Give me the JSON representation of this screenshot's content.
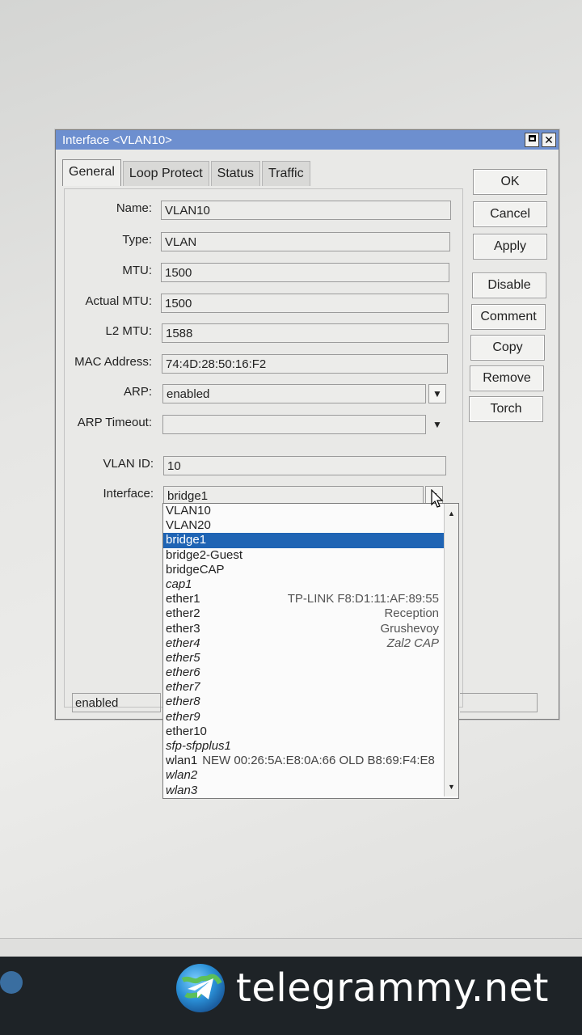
{
  "window": {
    "title": "Interface <VLAN10>"
  },
  "tabs": [
    "General",
    "Loop Protect",
    "Status",
    "Traffic"
  ],
  "fields": {
    "name": {
      "label": "Name:",
      "value": "VLAN10"
    },
    "type": {
      "label": "Type:",
      "value": "VLAN"
    },
    "mtu": {
      "label": "MTU:",
      "value": "1500"
    },
    "actual_mtu": {
      "label": "Actual MTU:",
      "value": "1500"
    },
    "l2_mtu": {
      "label": "L2 MTU:",
      "value": "1588"
    },
    "mac": {
      "label": "MAC Address:",
      "value": "74:4D:28:50:16:F2"
    },
    "arp": {
      "label": "ARP:",
      "value": "enabled"
    },
    "arp_timeout": {
      "label": "ARP Timeout:",
      "value": ""
    },
    "vlan_id": {
      "label": "VLAN ID:",
      "value": "10"
    },
    "interface": {
      "label": "Interface:",
      "value": "bridge1"
    }
  },
  "buttons": [
    "OK",
    "Cancel",
    "Apply",
    "Disable",
    "Comment",
    "Copy",
    "Remove",
    "Torch"
  ],
  "status": "enabled",
  "dropdown": {
    "items": [
      {
        "name": "VLAN10",
        "comment": ""
      },
      {
        "name": "VLAN20",
        "comment": ""
      },
      {
        "name": "bridge1",
        "comment": "",
        "selected": true
      },
      {
        "name": "bridge2-Guest",
        "comment": ""
      },
      {
        "name": "bridgeCAP",
        "comment": ""
      },
      {
        "name": "cap1",
        "comment": "",
        "inactive": true
      },
      {
        "name": "ether1",
        "comment": "TP-LINK F8:D1:11:AF:89:55"
      },
      {
        "name": "ether2",
        "comment": "Reception"
      },
      {
        "name": "ether3",
        "comment": "Grushevoy"
      },
      {
        "name": "ether4",
        "comment": "Zal2 CAP",
        "inactive": true
      },
      {
        "name": "ether5",
        "comment": "",
        "inactive": true
      },
      {
        "name": "ether6",
        "comment": "",
        "inactive": true
      },
      {
        "name": "ether7",
        "comment": "",
        "inactive": true
      },
      {
        "name": "ether8",
        "comment": "",
        "inactive": true
      },
      {
        "name": "ether9",
        "comment": "",
        "inactive": true
      },
      {
        "name": "ether10",
        "comment": ""
      },
      {
        "name": "sfp-sfpplus1",
        "comment": "",
        "inactive": true
      },
      {
        "name": "wlan1",
        "comment": "NEW 00:26:5A:E8:0A:66 OLD B8:69:F4:E8",
        "inline": true
      },
      {
        "name": "wlan2",
        "comment": "",
        "inactive": true
      },
      {
        "name": "wlan3",
        "comment": "",
        "inactive": true
      }
    ]
  },
  "watermark": "telegrammy.net"
}
